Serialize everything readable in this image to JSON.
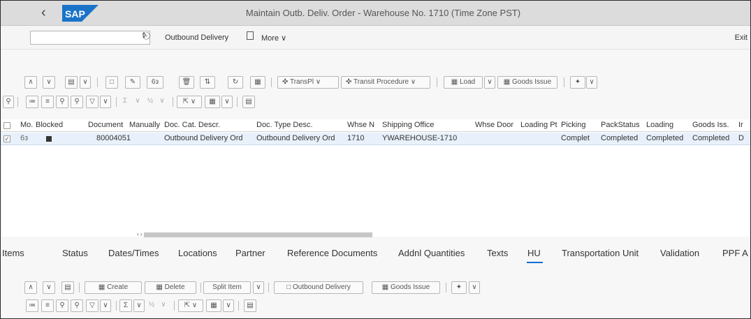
{
  "title": "Maintain Outb. Deliv. Order - Warehouse No. 1710 (Time Zone PST)",
  "brand": {
    "logo_text": "SAP",
    "color": "#1a73c8"
  },
  "menu": {
    "command_field_value": "",
    "outbound_delivery_label": "Outbound Delivery",
    "more_label": "More",
    "exit_label": "Exit"
  },
  "toolbar1": {
    "transpl_label": "TransPl",
    "transit_procedure_label": "Transit Procedure",
    "load_label": "Load",
    "goods_issue_label": "Goods Issue"
  },
  "table": {
    "columns": [
      "Mo.",
      "Blocked",
      "Document",
      "Manually",
      "Doc. Cat. Descr.",
      "Doc. Type Desc.",
      "Whse N",
      "Shipping Office",
      "Whse Door",
      "Loading Pt",
      "Picking",
      "PackStatus",
      "Loading",
      "Goods Iss.",
      "Ir"
    ],
    "row": {
      "document": "80004051",
      "doc_cat": "Outbound Delivery Ord",
      "doc_type": "Outbound Delivery Ord",
      "whse": "1710",
      "shipping_office": "YWAREHOUSE-1710",
      "picking": "Complet",
      "pack_status": "Completed",
      "loading": "Completed",
      "goods_iss": "Completed",
      "ir": "D"
    }
  },
  "tabs": [
    "Items",
    "Status",
    "Dates/Times",
    "Locations",
    "Partner",
    "Reference Documents",
    "Addnl Quantities",
    "Texts",
    "HU",
    "Transportation Unit",
    "Validation",
    "PPF A"
  ],
  "active_tab": "HU",
  "toolbar3": {
    "create_label": "Create",
    "delete_label": "Delete",
    "split_item_label": "Split Item",
    "outbound_delivery_label": "Outbound Delivery",
    "goods_issue_label": "Goods Issue"
  }
}
